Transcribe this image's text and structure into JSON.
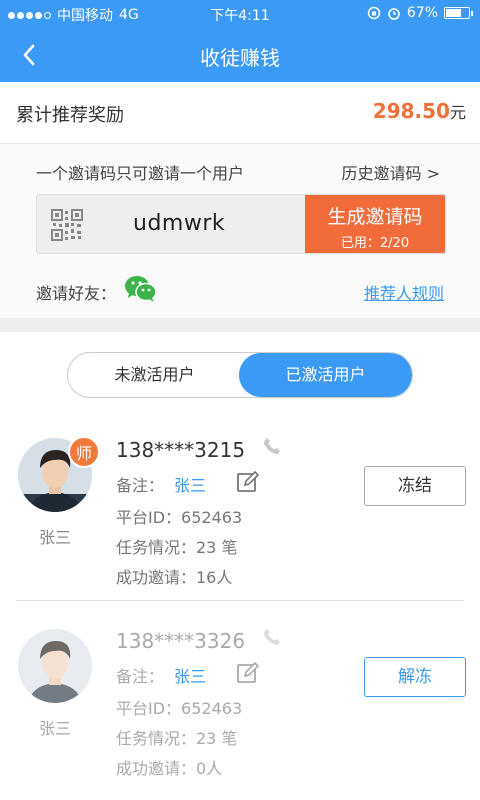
{
  "status_bar": {
    "carrier": "中国移动",
    "network": "4G",
    "time": "下午4:11",
    "battery": "67%",
    "battery_level": 0.67
  },
  "nav": {
    "title": "收徒赚钱",
    "back_icon": "chevron-left-icon"
  },
  "reward": {
    "label": "累计推荐奖励",
    "amount": "298.50",
    "unit": "元",
    "amount_color": "#f0703a"
  },
  "invite": {
    "note": "一个邀请码只可邀请一个用户",
    "history_link": "历史邀请码 >",
    "code": "udmwrk",
    "generate_label": "生成邀请码",
    "used_text": "已用：2/20",
    "friends_label": "邀请好友：",
    "share_icon": "wechat-icon",
    "rules_link": "推荐人规则"
  },
  "toggle": {
    "inactive_label": "未激活用户",
    "active_label": "已激活用户"
  },
  "users": [
    {
      "badge": "师",
      "name": "张三",
      "phone": "138****3215",
      "note_label": "备注：",
      "note_value": "张三",
      "platform_id": "平台ID：652463",
      "tasks": "任务情况：23  笔",
      "invites": "成功邀请：16人",
      "action": "冻结"
    },
    {
      "name": "张三",
      "phone": "138****3326",
      "note_label": "备注：",
      "note_value": "张三",
      "platform_id": "平台ID：652463",
      "tasks": "任务情况：23  笔",
      "invites": "成功邀请：0人",
      "action": "解冻"
    }
  ],
  "colors": {
    "primary": "#3a9af5",
    "accent": "#f26b3a"
  }
}
